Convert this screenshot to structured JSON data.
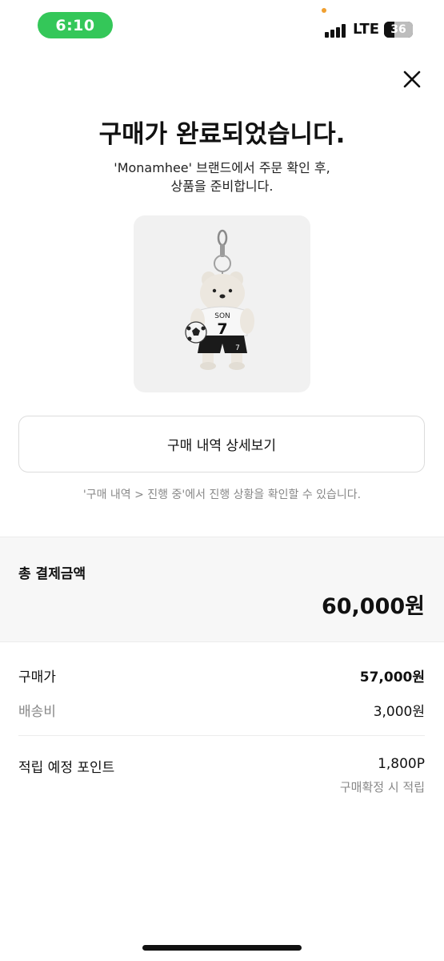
{
  "status_bar": {
    "time": "6:10",
    "network": "LTE",
    "battery": "36",
    "battery_level": 0.36,
    "accent_color": "#34c759"
  },
  "header": {
    "close_icon": "close-icon"
  },
  "confirmation": {
    "title": "구매가 완료되었습니다.",
    "subtitle_line1": "'Monamhee' 브랜드에서 주문 확인 후,",
    "subtitle_line2": "상품을 준비합니다."
  },
  "product": {
    "jersey_text": "SON",
    "jersey_number": "7"
  },
  "actions": {
    "detail_button_label": "구매 내역 상세보기",
    "hint": "'구매 내역 > 진행 중'에서 진행 상황을 확인할 수 있습니다."
  },
  "total": {
    "label": "총 결제금액",
    "value": "60,000원"
  },
  "breakdown": {
    "purchase_label": "구매가",
    "purchase_value": "57,000원",
    "shipping_label": "배송비",
    "shipping_value": "3,000원",
    "points_label": "적립 예정 포인트",
    "points_value": "1,800P",
    "points_note": "구매확정 시 적립"
  }
}
